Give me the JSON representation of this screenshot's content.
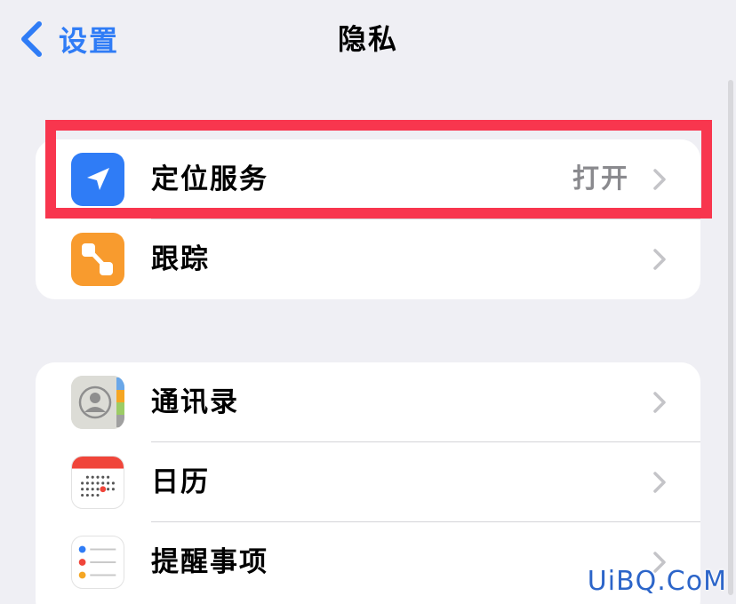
{
  "nav": {
    "back_label": "设置",
    "title": "隐私"
  },
  "groups": [
    {
      "items": [
        {
          "label": "定位服务",
          "value": "打开",
          "icon": "location-arrow-icon",
          "icon_bg": "#2f7cf6"
        },
        {
          "label": "跟踪",
          "icon": "tracking-icon",
          "icon_bg": "#f89b2e"
        }
      ]
    },
    {
      "items": [
        {
          "label": "通讯录",
          "icon": "contacts-icon"
        },
        {
          "label": "日历",
          "icon": "calendar-icon"
        },
        {
          "label": "提醒事项",
          "icon": "reminders-icon"
        }
      ]
    }
  ],
  "watermark": "UiBQ.CoM",
  "colors": {
    "accent": "#2f7cf6",
    "highlight": "#f8364e",
    "background": "#efeff4",
    "secondary_text": "#8a8a8e"
  }
}
